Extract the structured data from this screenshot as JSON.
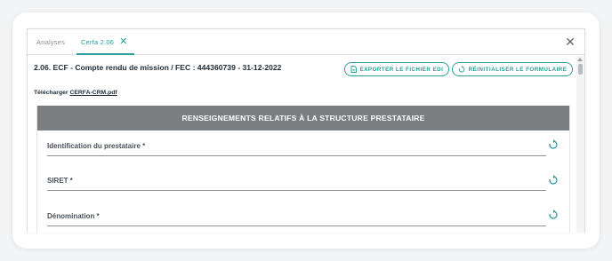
{
  "tabs": [
    {
      "label": "Analyses",
      "active": false
    },
    {
      "label": "Cerfa 2.06",
      "active": true
    }
  ],
  "icons": {
    "tab_close": "close-icon",
    "window_close": "close-icon",
    "export": "file-icon",
    "reset": "refresh-icon",
    "field_reset": "refresh-icon"
  },
  "document": {
    "title": "2.06. ECF - Compte rendu de mission / FEC : 444360739 - 31-12-2022",
    "download_prefix": "Télécharger",
    "download_link": "CERFA-CRM.pdf"
  },
  "toolbar": {
    "export_label": "EXPORTER LE FICHIER EDI",
    "reset_label": "RÉINITIALISER LE FORMULAIRE"
  },
  "section": {
    "title": "RENSEIGNEMENTS RELATIFS À LA STRUCTURE PRESTATAIRE",
    "fields": [
      {
        "label": "Identification du prestataire *",
        "value": ""
      },
      {
        "label": "SIRET *",
        "value": ""
      },
      {
        "label": "Dénomination *",
        "value": ""
      }
    ]
  },
  "colors": {
    "accent": "#2a9d9a",
    "section_header_bg": "#7b7e81",
    "title_text": "#1e2b36",
    "label_text": "#4a5159"
  }
}
